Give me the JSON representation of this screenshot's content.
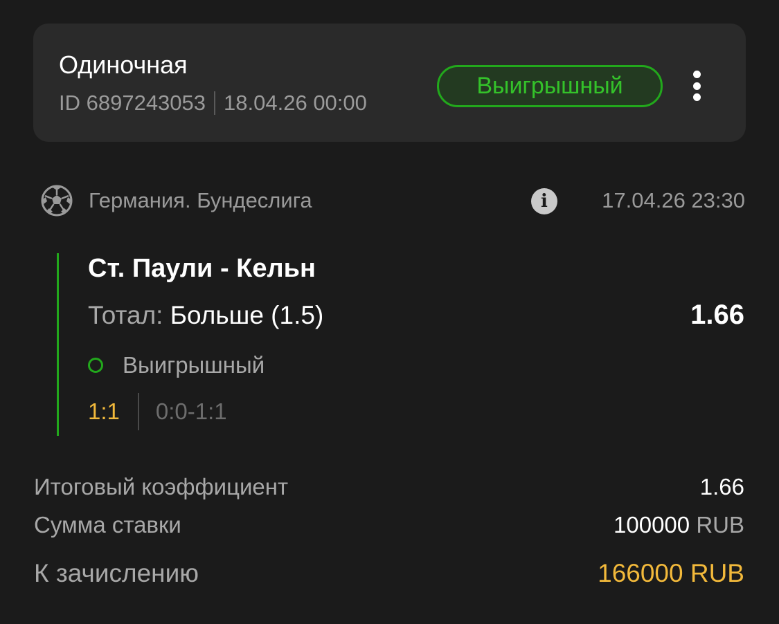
{
  "header": {
    "bet_type": "Одиночная",
    "bet_id": "ID 6897243053",
    "bet_datetime": "18.04.26 00:00",
    "status": "Выигрышный"
  },
  "league": {
    "icon": "soccer-ball-icon",
    "name": "Германия. Бундеслига",
    "info_icon": "info-icon",
    "info_glyph": "i",
    "event_datetime": "17.04.26 23:30"
  },
  "event": {
    "match": "Ст. Паули - Кельн",
    "market_label": "Тотал:",
    "market_value": "Больше (1.5)",
    "odds": "1.66",
    "result": "Выигрышный",
    "score": "1:1",
    "periods": "0:0-1:1"
  },
  "summary": {
    "total_odds_label": "Итоговый коэффициент",
    "total_odds_value": "1.66",
    "stake_label": "Сумма ставки",
    "stake_amount": "100000",
    "stake_currency": "RUB",
    "payout_label": "К зачислению",
    "payout_value": "166000 RUB"
  },
  "colors": {
    "background": "#1b1b1b",
    "card": "#2a2a2a",
    "win_green": "#22a81c",
    "payout_yellow": "#f2b93b",
    "muted_text": "#9a9a9a"
  }
}
